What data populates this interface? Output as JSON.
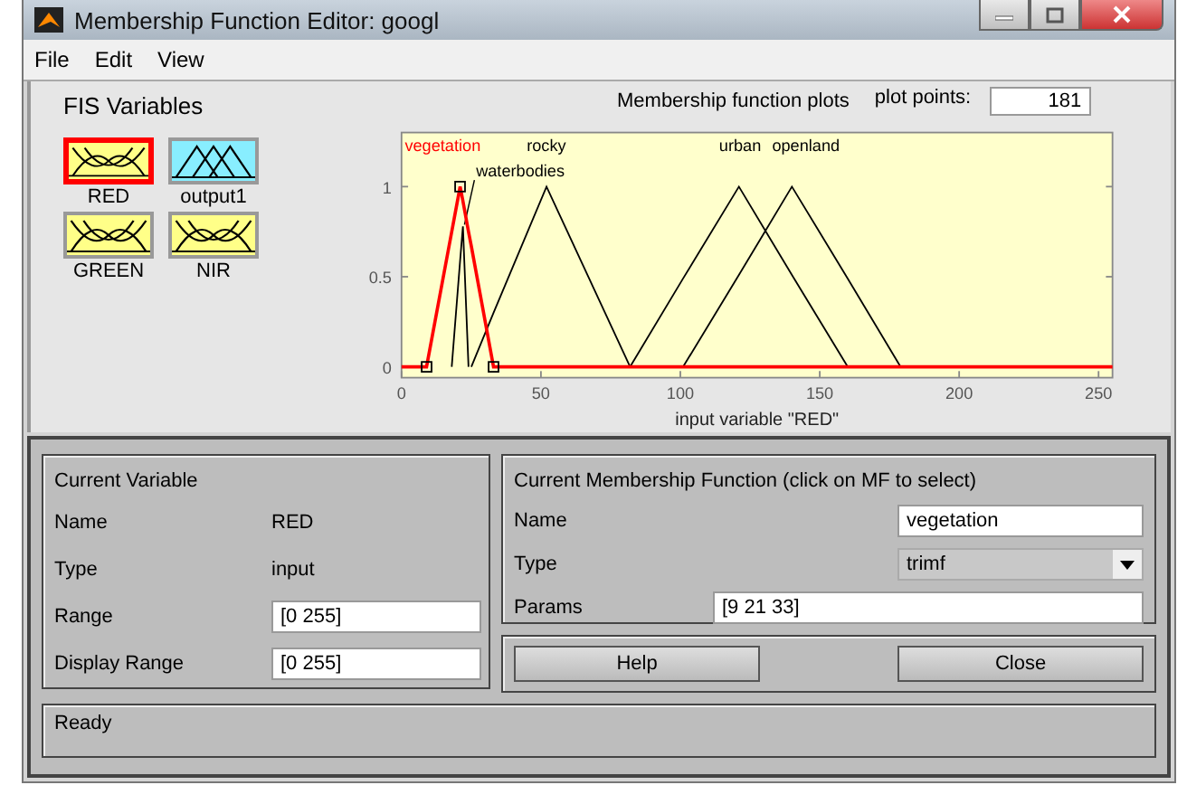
{
  "window": {
    "title": "Membership Function Editor: googl"
  },
  "menu": [
    "File",
    "Edit",
    "View"
  ],
  "fis_variables": {
    "title": "FIS Variables",
    "items": [
      {
        "name": "RED",
        "kind": "input",
        "selected": true
      },
      {
        "name": "output1",
        "kind": "output",
        "selected": false
      },
      {
        "name": "GREEN",
        "kind": "input",
        "selected": false
      },
      {
        "name": "NIR",
        "kind": "input",
        "selected": false
      }
    ]
  },
  "plot": {
    "plot_points_label": "plot points:",
    "plot_points": "181",
    "chart_data": {
      "type": "line",
      "title": "Membership function plots",
      "xlabel": "input variable \"RED\"",
      "x": [
        0,
        9,
        18,
        21,
        22,
        24,
        25,
        33,
        52,
        82,
        101,
        121,
        140,
        160,
        179,
        255
      ],
      "series": [
        {
          "name": "vegetation",
          "color": "#ff0000",
          "values": [
            0,
            0,
            0.75,
            1,
            0.92,
            0.75,
            0.67,
            0,
            0,
            0,
            0,
            0,
            0,
            0,
            0,
            0
          ]
        },
        {
          "name": "waterbodies",
          "color": "#000000",
          "values": [
            null,
            null,
            0,
            0.59,
            0.78,
            0,
            null,
            null,
            null,
            null,
            null,
            null,
            null,
            null,
            null,
            null
          ]
        },
        {
          "name": "rocky",
          "color": "#000000",
          "values": [
            null,
            null,
            null,
            null,
            null,
            null,
            0,
            0.3,
            1,
            0,
            null,
            null,
            null,
            null,
            null,
            null
          ]
        },
        {
          "name": "urban",
          "color": "#000000",
          "values": [
            null,
            null,
            null,
            null,
            null,
            null,
            null,
            null,
            null,
            0,
            0.49,
            1,
            0.51,
            0,
            null,
            null
          ]
        },
        {
          "name": "openland",
          "color": "#000000",
          "values": [
            null,
            null,
            null,
            null,
            null,
            null,
            null,
            null,
            null,
            null,
            0,
            0.51,
            1,
            0.49,
            0,
            null
          ]
        }
      ],
      "xlim": [
        0,
        255
      ],
      "ylim": [
        -0.06,
        1.3
      ],
      "xticks": [
        0,
        50,
        100,
        150,
        200,
        250
      ],
      "yticks": [
        0,
        0.5,
        1
      ]
    }
  },
  "current_variable": {
    "title": "Current Variable",
    "name_label": "Name",
    "name": "RED",
    "type_label": "Type",
    "type": "input",
    "range_label": "Range",
    "range": "[0 255]",
    "display_range_label": "Display Range",
    "display_range": "[0 255]"
  },
  "current_mf": {
    "title": "Current Membership Function (click on MF to select)",
    "name_label": "Name",
    "name": "vegetation",
    "type_label": "Type",
    "type": "trimf",
    "params_label": "Params",
    "params": "[9 21 33]"
  },
  "buttons": [
    "Help",
    "Close"
  ],
  "status_bar": "Ready"
}
